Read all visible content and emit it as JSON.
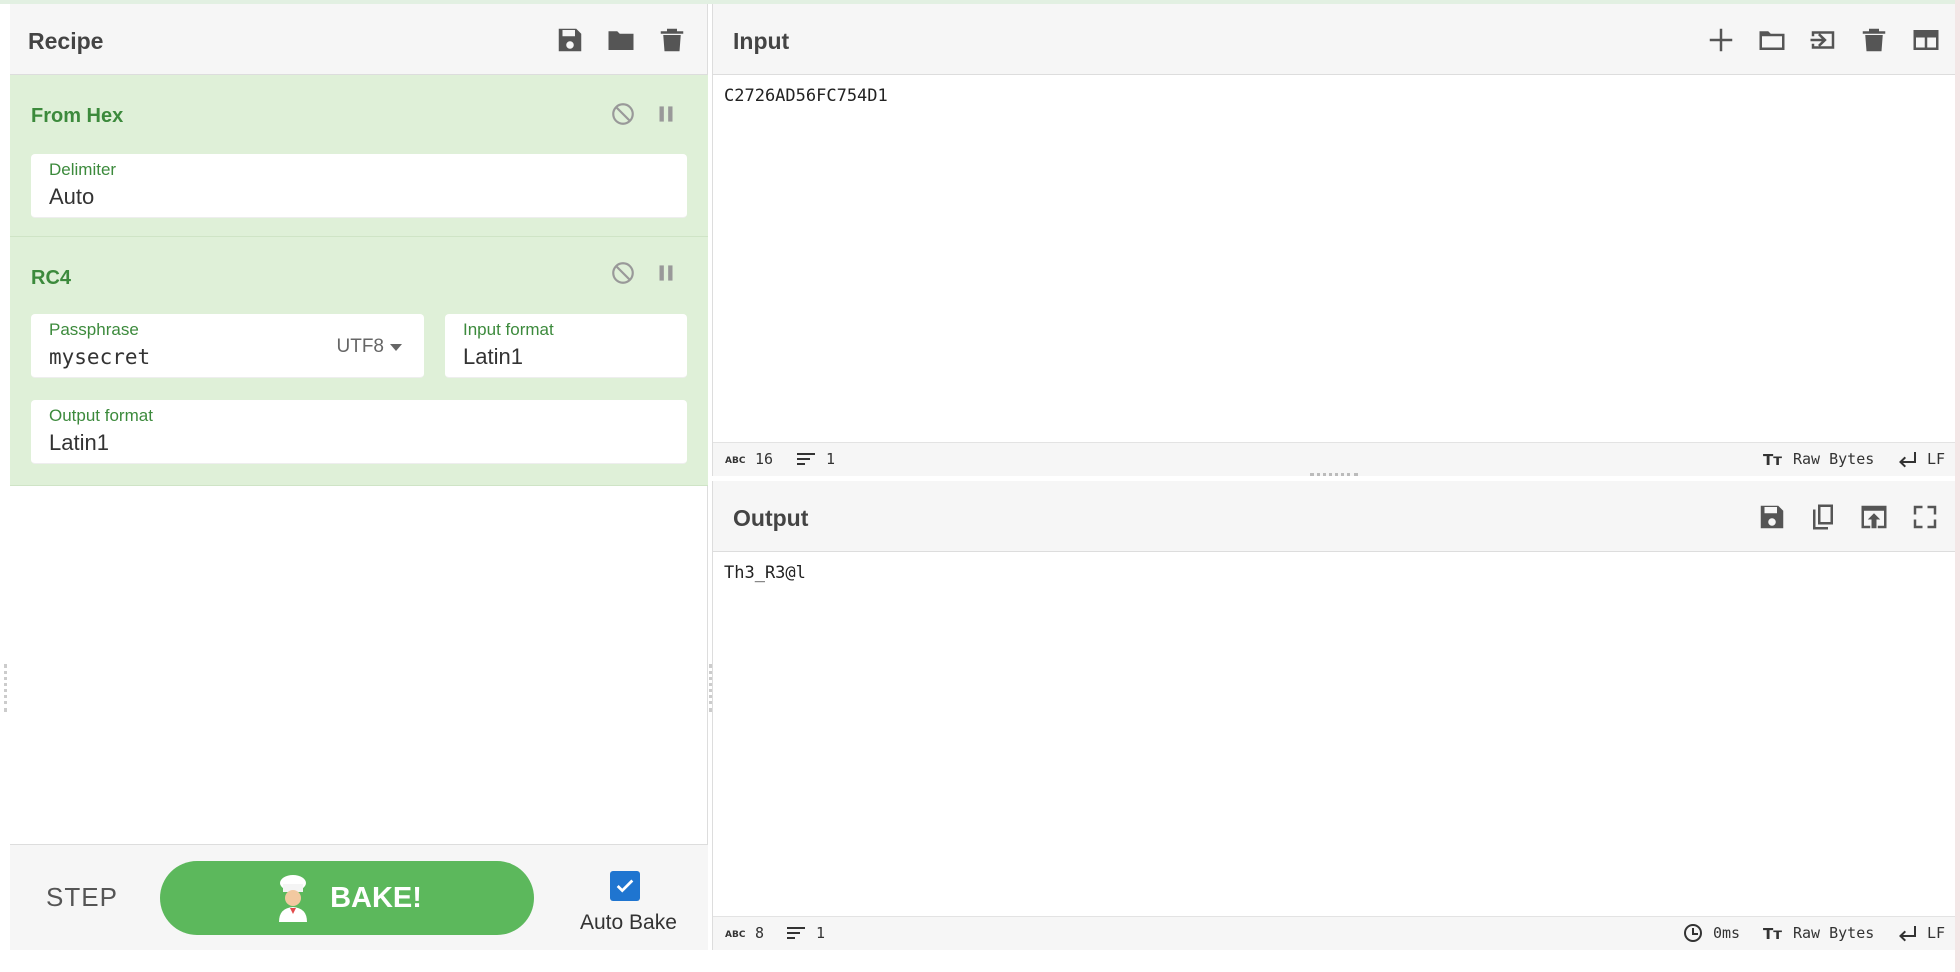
{
  "recipe": {
    "title": "Recipe",
    "operations": [
      {
        "name": "From Hex",
        "fields": [
          {
            "label": "Delimiter",
            "value": "Auto"
          }
        ]
      },
      {
        "name": "RC4",
        "fields": [
          {
            "label": "Passphrase",
            "value": "mysecret",
            "encoding": "UTF8"
          },
          {
            "label": "Input format",
            "value": "Latin1"
          },
          {
            "label": "Output format",
            "value": "Latin1"
          }
        ]
      }
    ],
    "step_label": "STEP",
    "bake_label": "BAKE!",
    "auto_bake_label": "Auto Bake",
    "auto_bake_checked": true
  },
  "input": {
    "title": "Input",
    "text": "C2726AD56FC754D1",
    "status": {
      "chars": "16",
      "lines": "1",
      "format": "Raw Bytes",
      "eol": "LF"
    }
  },
  "output": {
    "title": "Output",
    "text": "Th3_R3@l",
    "status": {
      "chars": "8",
      "lines": "1",
      "time": "0ms",
      "format": "Raw Bytes",
      "eol": "LF"
    }
  },
  "colors": {
    "op_background": "#dff0d8",
    "op_text": "#3c8a3c",
    "bake_button": "#5cb85c",
    "checkbox": "#1f75d0"
  }
}
